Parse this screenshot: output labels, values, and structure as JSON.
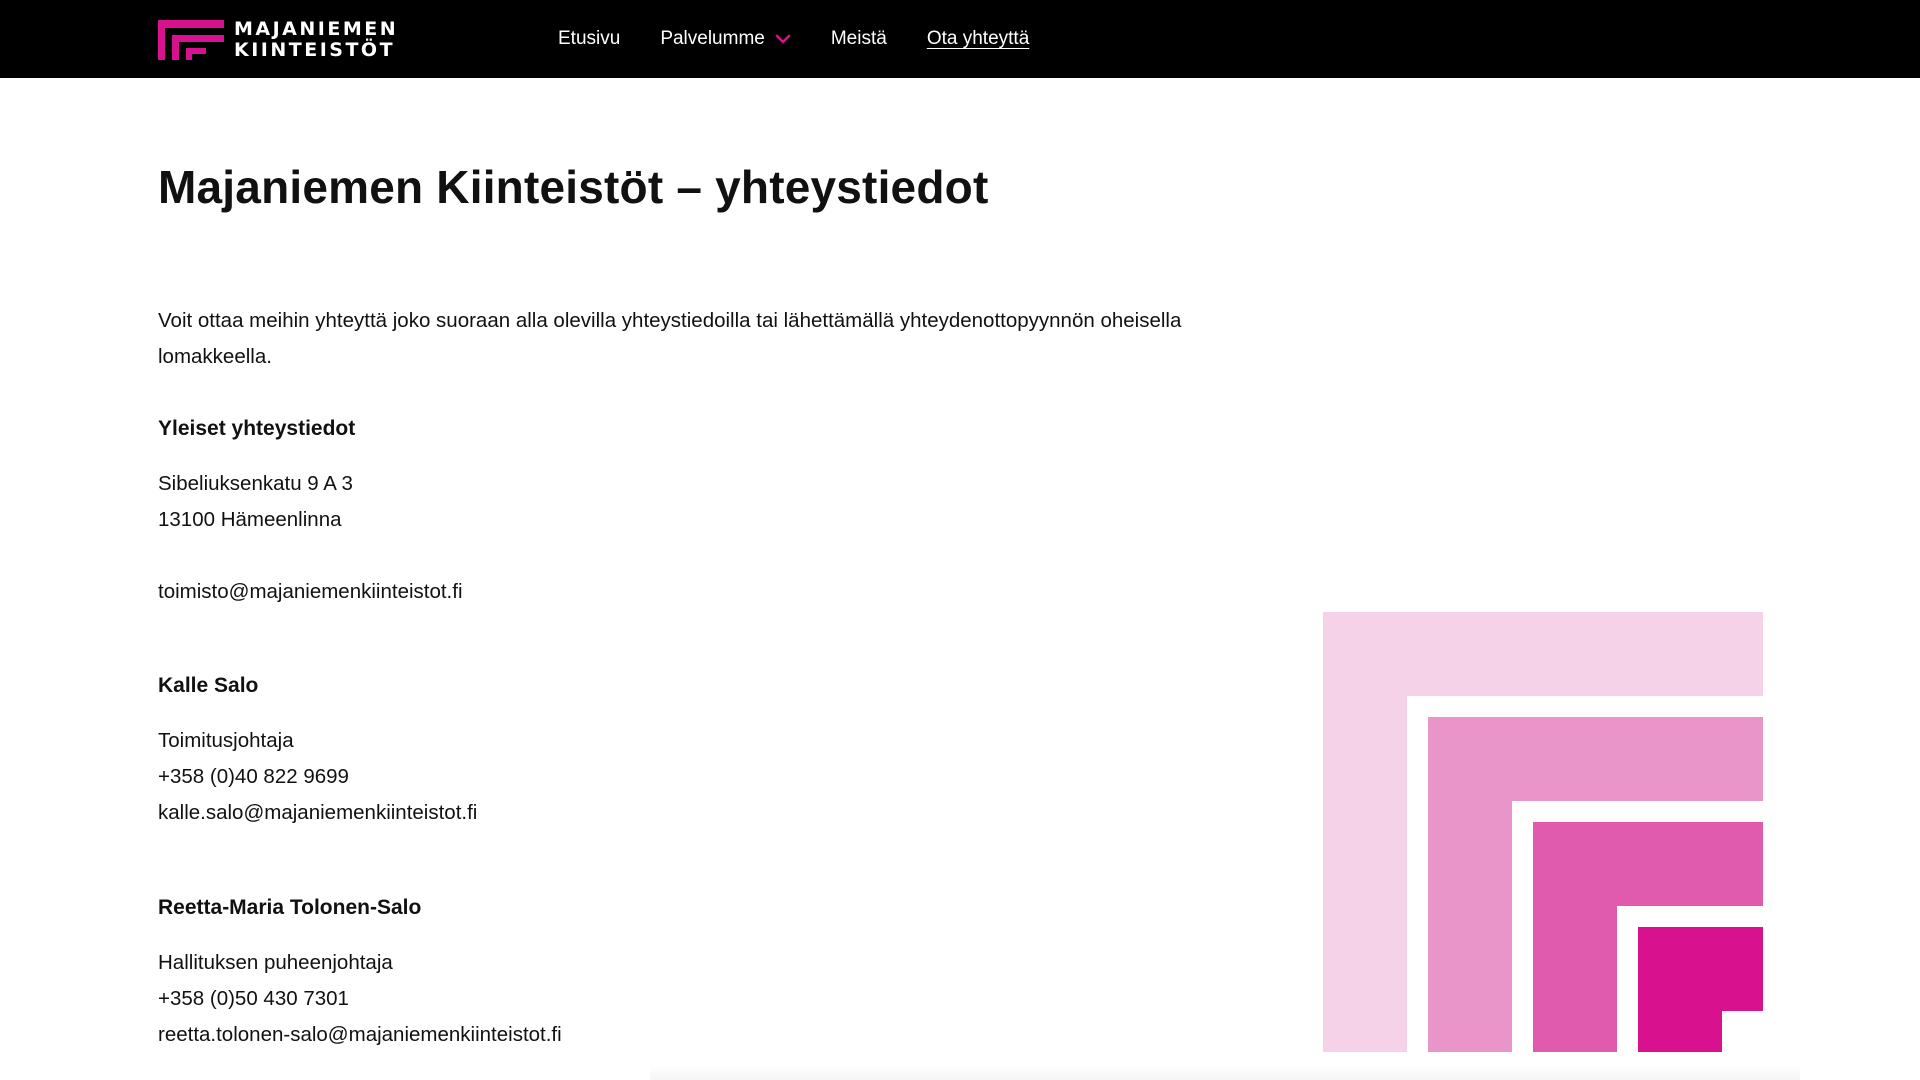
{
  "brand": {
    "line1": "MAJANIEMEN",
    "line2": "KIINTEISTÖT",
    "accent": "#d8118f"
  },
  "nav": {
    "items": [
      "Etusivu",
      "Palvelumme",
      "Meistä",
      "Ota yhteyttä"
    ],
    "active": "Ota yhteyttä"
  },
  "page": {
    "title": "Majaniemen Kiinteistöt – yhteystiedot",
    "intro": "Voit ottaa meihin yhteyttä joko suoraan alla olevilla yhteystiedoilla tai lähettämällä yhteydenottopyynnön oheisella lomakkeella."
  },
  "general": {
    "heading": "Yleiset yhteystiedot",
    "street": "Sibeliuksenkatu 9 A 3",
    "city": "13100 Hämeenlinna",
    "email": "toimisto@majaniemenkiinteistot.fi"
  },
  "contacts": [
    {
      "name": "Kalle Salo",
      "role": "Toimitusjohtaja",
      "phone": "+358 (0)40 822 9699",
      "email": "kalle.salo@majaniemenkiinteistot.fi"
    },
    {
      "name": "Reetta-Maria Tolonen-Salo",
      "role": "Hallituksen puheenjohtaja",
      "phone": "+358 (0)50 430 7301",
      "email": "reetta.tolonen-salo@majaniemenkiinteistot.fi"
    }
  ],
  "decoration": {
    "colors": [
      "#f6d2e8",
      "#ea95c9",
      "#e05aad",
      "#d8118f"
    ]
  }
}
